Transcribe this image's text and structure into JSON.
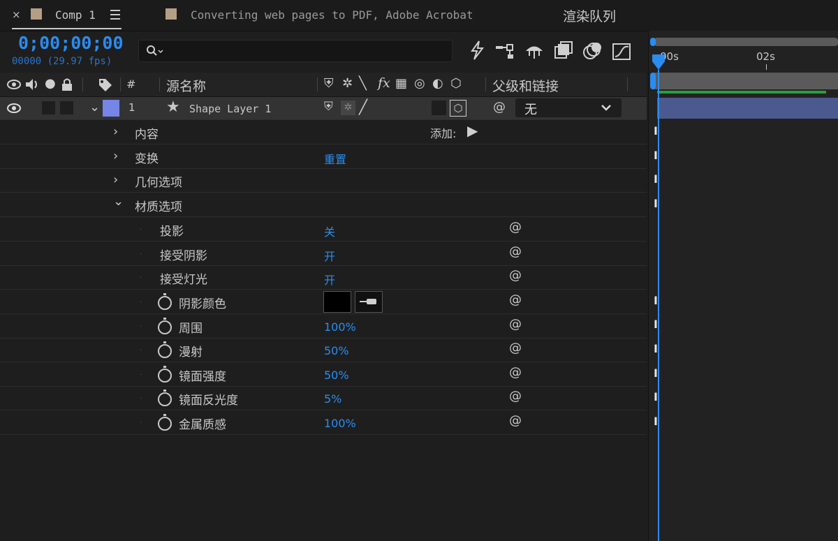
{
  "tabs": [
    {
      "close": "×",
      "label": "Comp 1",
      "active": true
    },
    {
      "label": "Converting web pages to PDF, Adobe Acrobat"
    },
    {
      "label": "渲染队列"
    }
  ],
  "timecode": "0;00;00;00",
  "frame_info": "00000 (29.97 fps)",
  "search": {
    "placeholder": "",
    "icon": "search-icon"
  },
  "header": {
    "number": "#",
    "source_name": "源名称",
    "parent_link": "父级和链接"
  },
  "layer": {
    "number": "1",
    "name": "Shape Layer 1",
    "label_color": "#7585e8",
    "parent": "无"
  },
  "groups": [
    {
      "label": "内容",
      "expanded": false,
      "action": "添加:"
    },
    {
      "label": "变换",
      "expanded": false,
      "value": "重置"
    },
    {
      "label": "几何选项",
      "expanded": false
    },
    {
      "label": "材质选项",
      "expanded": true
    }
  ],
  "material": [
    {
      "label": "投影",
      "value": "关",
      "stopwatch": false
    },
    {
      "label": "接受阴影",
      "value": "开",
      "stopwatch": false
    },
    {
      "label": "接受灯光",
      "value": "开",
      "stopwatch": false
    },
    {
      "label": "阴影颜色",
      "value": "",
      "stopwatch": true,
      "color": "#000000"
    },
    {
      "label": "周围",
      "value": "100%",
      "stopwatch": true
    },
    {
      "label": "漫射",
      "value": "50%",
      "stopwatch": true
    },
    {
      "label": "镜面强度",
      "value": "50%",
      "stopwatch": true
    },
    {
      "label": "镜面反光度",
      "value": "5%",
      "stopwatch": true
    },
    {
      "label": "金属质感",
      "value": "100%",
      "stopwatch": true
    }
  ],
  "timeline": {
    "ruler_labels": [
      "00s",
      "02s"
    ],
    "accent": "#2b8cf0",
    "work_area_color": "#23a23a",
    "layer_bar_color": "#4a5a8e"
  }
}
